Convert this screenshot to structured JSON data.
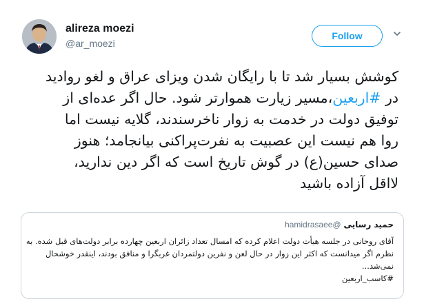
{
  "user": {
    "name": "alireza moezi",
    "handle": "@ar_moezi",
    "avatar_icon": "profile-photo"
  },
  "follow_label": "Follow",
  "menu_icon": "chevron-down-icon",
  "tweet": {
    "line1": "کوشش بسیار شد تا با رایگان شدن ویزای عراق و لغو روادید",
    "line2_prefix": "در ",
    "line2_hashtag": "#اربعین",
    "line2_suffix": "،مسیر زیارت هموارتر شود. حال اگر عده‌ای از",
    "line3": "توفیق دولت در خدمت به زوار ناخرسندند، گلایه نیست اما",
    "line4": "روا هم نیست این عصبیت به نفرت‌پراکنی بیانجامد؛ هنوز",
    "line5": "صدای حسین(ع) در گوش تاریخ است که اگر دین ندارید،",
    "line6": "لااقل آزاده باشید"
  },
  "quoted": {
    "name": "حمید رسایی",
    "handle": "@hamidrasaee",
    "line1": "آقای روحانی در جلسه هیأت دولت اعلام کرده که امسال تعداد زائران اربعین چهارده برابر دولت‌های قبل شده. به",
    "line2": "نظرم اگر میدانست که اکثر این زوار در حال لعن و نفرین دولتمردان غربگرا و منافق بودند، اینقدر خوشحال",
    "line3": "نمی‌شد...",
    "line4": "#کاسب_اربعین"
  },
  "colors": {
    "accent": "#1da1f2",
    "text": "#14171a",
    "muted": "#657786",
    "border": "#ccd6dd"
  }
}
